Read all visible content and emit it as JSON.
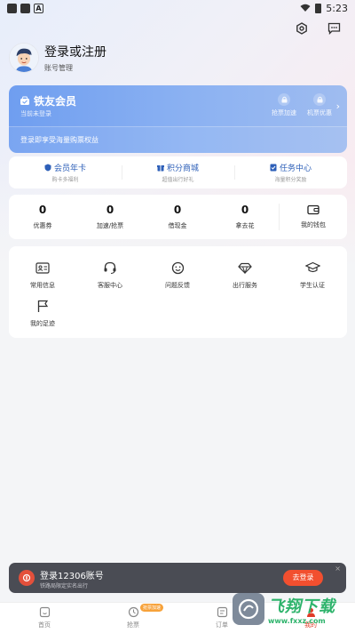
{
  "status_bar": {
    "time": "5:23"
  },
  "profile": {
    "title": "登录或注册",
    "subtitle": "账号管理"
  },
  "member_card": {
    "title": "铁友会员",
    "subtitle": "当前未登录",
    "benefits": [
      {
        "label": "抢票加速"
      },
      {
        "label": "机票优惠"
      }
    ],
    "promo": "登录即享受海量购票权益"
  },
  "quick_links": [
    {
      "title": "会员年卡",
      "sub": "购卡多福利"
    },
    {
      "title": "积分商城",
      "sub": "超值出行好礼"
    },
    {
      "title": "任务中心",
      "sub": "海量积分奖励"
    }
  ],
  "stats": [
    {
      "value": "0",
      "label": "优惠券"
    },
    {
      "value": "0",
      "label": "加速/抢票"
    },
    {
      "value": "0",
      "label": "借现金"
    },
    {
      "value": "0",
      "label": "拿去花"
    }
  ],
  "wallet": {
    "label": "我的钱包"
  },
  "services": [
    {
      "label": "常用信息",
      "icon": "id-card-icon"
    },
    {
      "label": "客服中心",
      "icon": "headset-icon"
    },
    {
      "label": "问题反馈",
      "icon": "feedback-icon"
    },
    {
      "label": "出行服务",
      "icon": "diamond-icon"
    },
    {
      "label": "学生认证",
      "icon": "graduation-cap-icon"
    },
    {
      "label": "我的足迹",
      "icon": "flag-icon"
    }
  ],
  "login_banner": {
    "title": "登录12306账号",
    "subtitle": "铁路局限定实名出行",
    "button": "去登录",
    "close": "×"
  },
  "tabs": [
    {
      "label": "首页",
      "icon": "home-icon"
    },
    {
      "label": "抢票",
      "icon": "clock-icon",
      "badge": "抢票加速"
    },
    {
      "label": "订单",
      "icon": "order-icon"
    },
    {
      "label": "我的",
      "icon": "user-icon"
    }
  ],
  "watermark": {
    "main": "飞翔下载",
    "url": "www.fxxz.com"
  },
  "colors": {
    "accent": "#e03a27",
    "card_blue": "#7aa6f0",
    "link_blue": "#2d5fb8"
  }
}
